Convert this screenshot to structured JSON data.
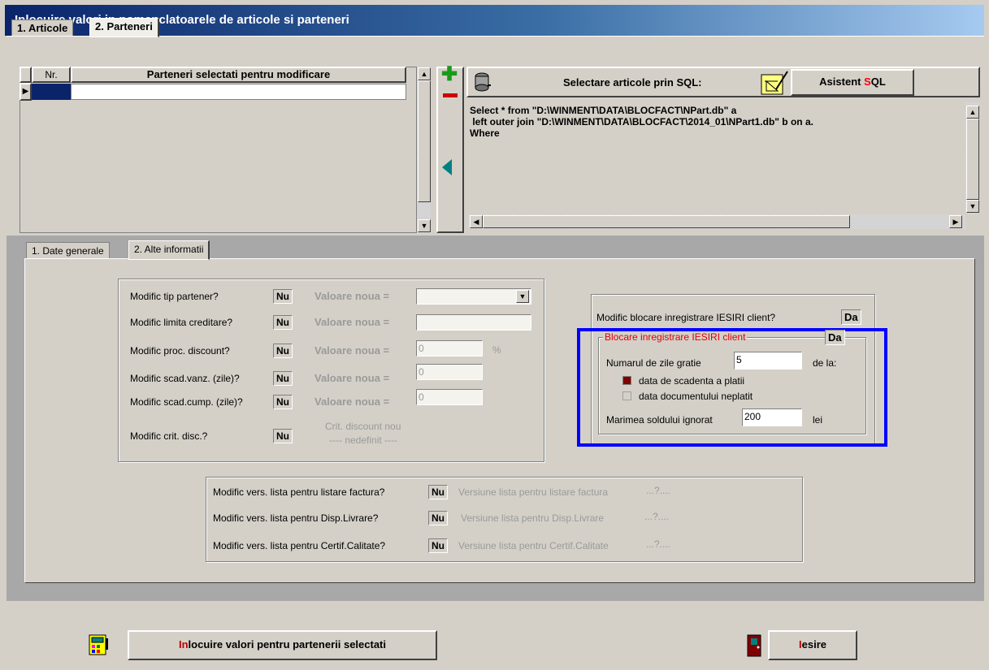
{
  "window": {
    "title": "Inlocuire valori in nomenclatoarele de articole si parteneri"
  },
  "main_tabs": [
    {
      "label": "1. Articole"
    },
    {
      "label": "2. Parteneri"
    }
  ],
  "grid": {
    "col_nr": "Nr.",
    "col_name": "Parteneri selectati pentru modificare"
  },
  "sql": {
    "label": "Selectare articole prin SQL:",
    "assistant_label_pre": "Asistent ",
    "assistant_label_hl": "S",
    "assistant_label_post": "QL",
    "line1": "Select * from \"D:\\WINMENT\\DATA\\BLOCFACT\\NPart.db\" a",
    "line2": " left outer join \"D:\\WINMENT\\DATA\\BLOCFACT\\2014_01\\NPart1.db\" b on a.",
    "line3": "Where"
  },
  "sub_tabs": [
    {
      "label": "1. Date generale"
    },
    {
      "label": "2. Alte informatii"
    }
  ],
  "left_group": {
    "rows": [
      {
        "label": "Modific tip partener?",
        "flag": "Nu",
        "vlabel": "Valoare noua =",
        "value": ""
      },
      {
        "label": "Modific limita creditare?",
        "flag": "Nu",
        "vlabel": "Valoare noua =",
        "value": ""
      },
      {
        "label": "Modific proc. discount?",
        "flag": "Nu",
        "vlabel": "Valoare noua =",
        "value": "0",
        "suffix": "%"
      },
      {
        "label": "Modific scad.vanz. (zile)?",
        "flag": "Nu",
        "vlabel": "Valoare noua =",
        "value": "0"
      },
      {
        "label": "Modific scad.cump. (zile)?",
        "flag": "Nu",
        "vlabel": "Valoare noua =",
        "value": "0"
      }
    ],
    "crit": {
      "label": "Modific crit. disc.?",
      "flag": "Nu",
      "line1": "Crit. discount nou",
      "line2": "---- nedefinit ----"
    }
  },
  "right_group": {
    "block_label": "Modific blocare inregistrare IESIRI client?",
    "block_flag": "Da",
    "inner_title": "Blocare inregistrare IESIRI client",
    "inner_flag": "Da",
    "grace_label": "Numarul de zile gratie",
    "grace_value": "5",
    "from_label": "de la:",
    "opt1": "data de scadenta a platii",
    "opt2": "data documentului neplatit",
    "balance_label": "Marimea soldului ignorat",
    "balance_value": "200",
    "unit": "lei",
    "highlight_color": "#0000ff",
    "selected_color": "#800000"
  },
  "bottom_group": {
    "rows": [
      {
        "label": "Modific vers. lista pentru listare factura?",
        "flag": "Nu",
        "desc": "Versiune lista pentru listare factura",
        "val": "...?...."
      },
      {
        "label": "Modific vers. lista pentru Disp.Livrare?",
        "flag": "Nu",
        "desc": "Versiune lista pentru Disp.Livrare",
        "val": "...?...."
      },
      {
        "label": "Modific vers. lista pentru Certif.Calitate?",
        "flag": "Nu",
        "desc": "Versiune lista pentru Certif.Calitate",
        "val": "...?...."
      }
    ]
  },
  "buttons": {
    "replace_pre": "In",
    "replace_rest": "locuire valori pentru partenerii selectati",
    "exit_pre": "I",
    "exit_rest": "esire"
  }
}
